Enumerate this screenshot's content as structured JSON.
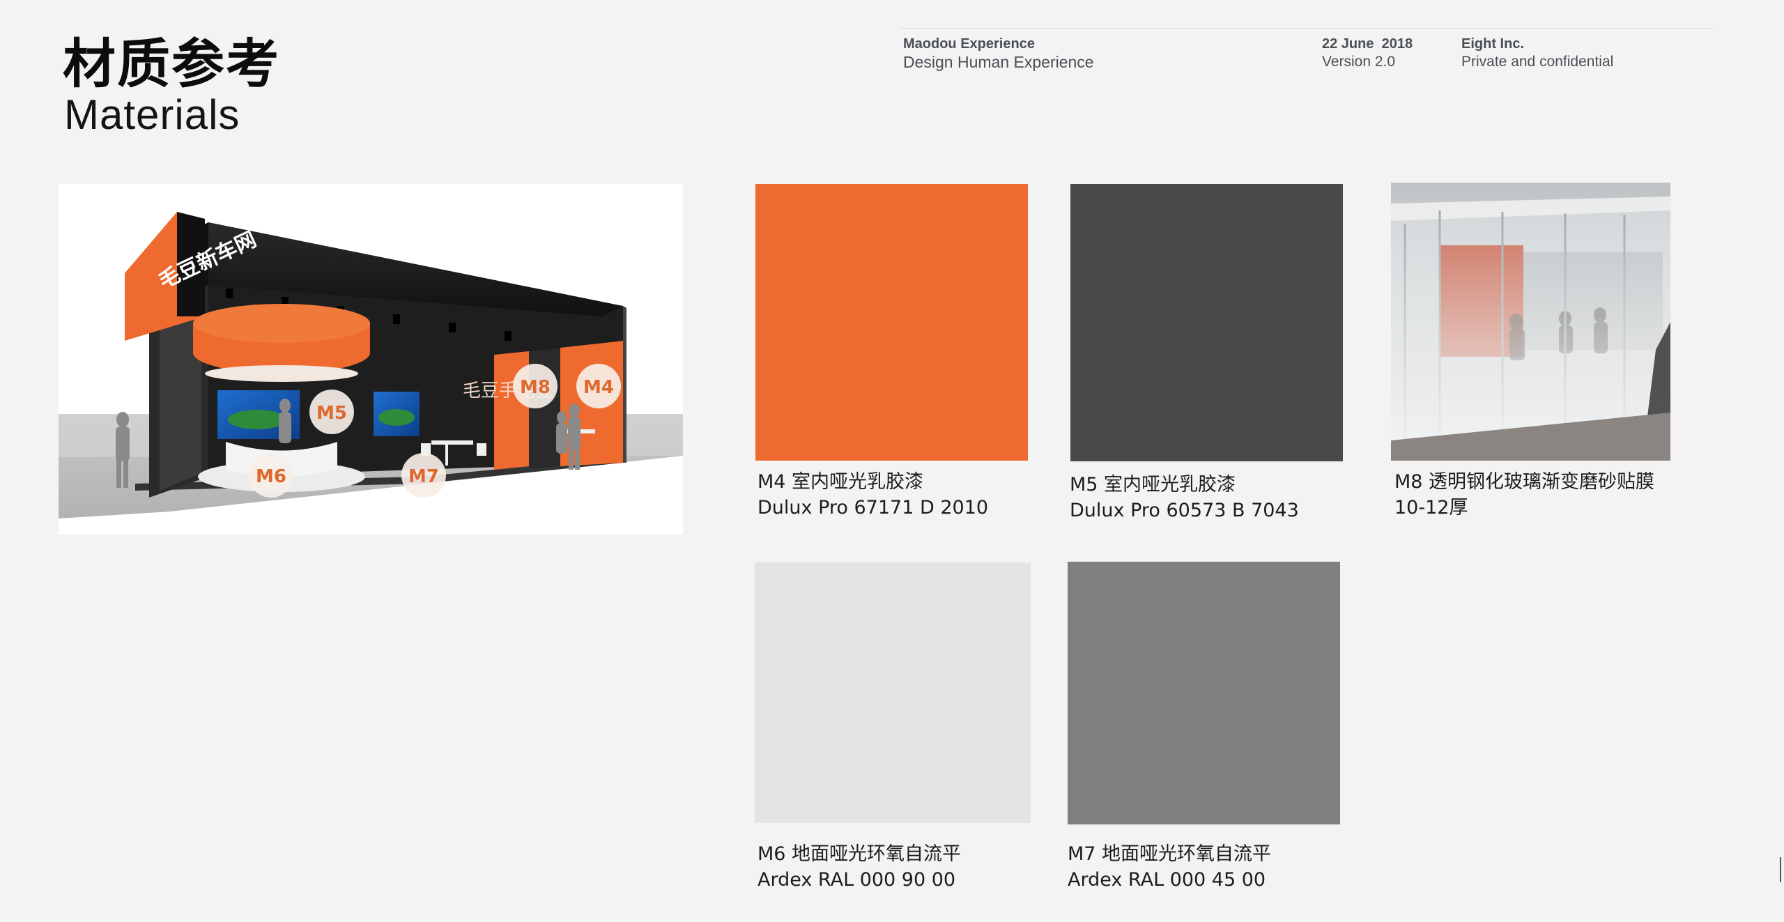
{
  "header": {
    "title_zh": "材质参考",
    "title_en": "Materials"
  },
  "meta": {
    "project": "Maodou Experience",
    "subtitle": "Design Human Experience",
    "date": "22 June  2018",
    "version": "Version 2.0",
    "company": "Eight Inc.",
    "confidentiality": "Private and confidential"
  },
  "booth_render": {
    "sign_text": "毛豆新车网",
    "wall_text": "毛豆手毛豆",
    "markers": [
      "M5",
      "M8",
      "M4",
      "M6",
      "M7"
    ]
  },
  "materials": [
    {
      "code_line": "M4 室内哑光乳胶漆",
      "spec": "Dulux Pro 67171 D 2010",
      "color": "#ef6a2e"
    },
    {
      "code_line": "M5 室内哑光乳胶漆",
      "spec": "Dulux Pro 60573 B 7043",
      "color": "#4a4a4a"
    },
    {
      "code_line": "M8 透明钢化玻璃渐变磨砂贴膜",
      "spec": "10-12厚",
      "image": "frosted-glass-office-photo"
    },
    {
      "code_line": "M6 地面哑光环氧自流平",
      "spec": "Ardex RAL 000 90 00",
      "color": "#e2e3e2"
    },
    {
      "code_line": "M7 地面哑光环氧自流平",
      "spec": "Ardex RAL 000 45 00",
      "color": "#7f7f7f"
    }
  ],
  "accent_color": "#ef6a2e"
}
